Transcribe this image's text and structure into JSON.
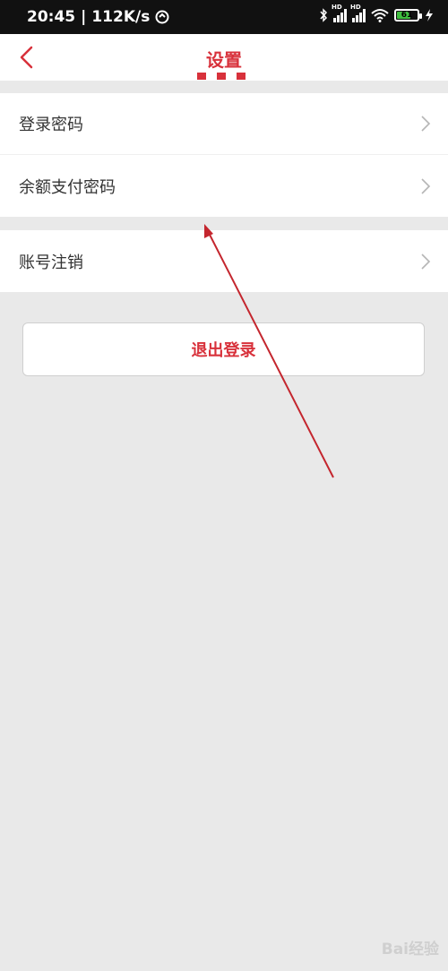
{
  "status_bar": {
    "time": "20:45",
    "speed": "112K/s",
    "signal_1": "HD",
    "signal_2": "HD",
    "battery": "61",
    "icons": [
      "bluetooth-icon",
      "signal-icon",
      "signal-icon",
      "wifi-icon",
      "battery-icon",
      "charging-icon"
    ]
  },
  "header": {
    "title": "设置",
    "back_icon": "chevron-left-icon"
  },
  "settings": {
    "section1": [
      {
        "label": "登录密码"
      },
      {
        "label": "余额支付密码"
      }
    ],
    "section2": [
      {
        "label": "账号注销"
      }
    ]
  },
  "logout_label": "退出登录",
  "watermark": "Bai经验",
  "colors": {
    "accent": "#d8313b",
    "background": "#e9e9e9",
    "status_bar": "#111111"
  }
}
